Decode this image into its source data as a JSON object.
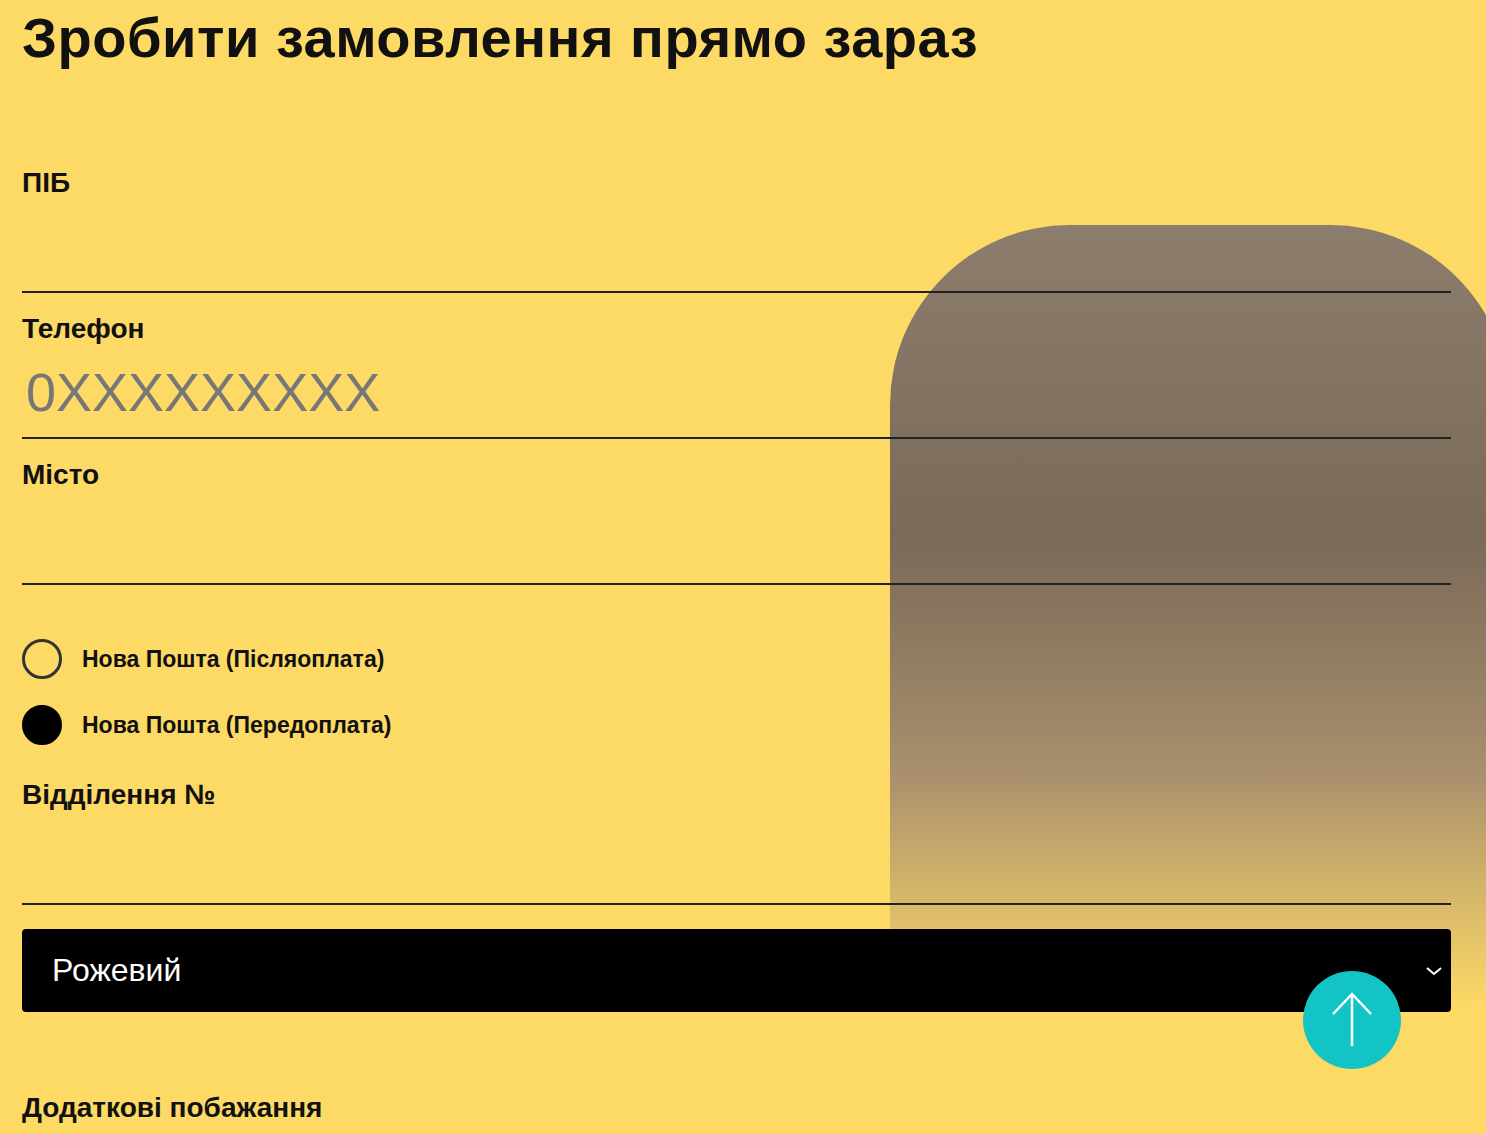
{
  "title": "Зробити замовлення прямо зараз",
  "fields": [
    {
      "label": "ПІБ",
      "placeholder": ""
    },
    {
      "label": "Телефон",
      "placeholder": "0XXXXXXXXX"
    },
    {
      "label": "Місто",
      "placeholder": ""
    }
  ],
  "delivery": [
    {
      "label": "Нова Пошта (Післяоплата)",
      "selected": false
    },
    {
      "label": "Нова Пошта (Передоплата)",
      "selected": true
    }
  ],
  "branch": {
    "label": "Відділення №",
    "placeholder": ""
  },
  "color_select": {
    "value": "Рожевий"
  },
  "wishes": {
    "label": "Додаткові побажання"
  }
}
